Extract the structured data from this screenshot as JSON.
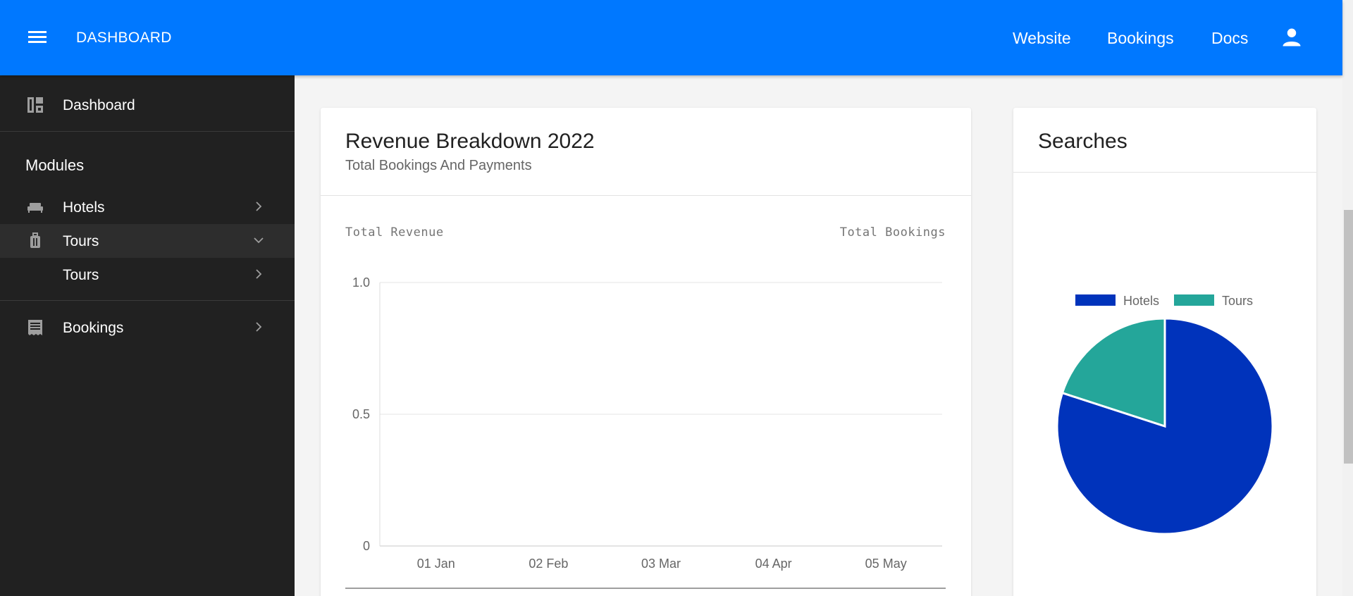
{
  "header": {
    "brand": "DASHBOARD",
    "nav": [
      "Website",
      "Bookings",
      "Docs"
    ],
    "icons": {
      "menu": "menu-icon",
      "user": "user-icon"
    }
  },
  "sidebar": {
    "dashboard_label": "Dashboard",
    "section_title": "Modules",
    "items": [
      {
        "label": "Hotels",
        "icon": "bed-icon",
        "chevron": "chevron-right"
      },
      {
        "label": "Tours",
        "icon": "luggage-icon",
        "chevron": "chevron-down"
      },
      {
        "label": "Tours",
        "icon": "",
        "chevron": "chevron-right"
      },
      {
        "label": "Bookings",
        "icon": "receipt-icon",
        "chevron": "chevron-right"
      }
    ]
  },
  "revenue_card": {
    "title": "Revenue Breakdown 2022",
    "subtitle": "Total Bookings And Payments",
    "left_axis_label": "Total Revenue",
    "right_axis_label": "Total Bookings"
  },
  "searches_card": {
    "title": "Searches"
  },
  "colors": {
    "header": "#0078ff",
    "sidebar": "#212121",
    "hotels": "#0033bb",
    "tours": "#24a69a"
  },
  "chart_data": [
    {
      "type": "line",
      "categories": [
        "01 Jan",
        "02 Feb",
        "03 Mar",
        "04 Apr",
        "05 May"
      ],
      "yticks": [
        "1.0",
        "0.5",
        "0"
      ],
      "ylim": [
        0,
        1
      ],
      "series": [],
      "grid": true
    },
    {
      "type": "pie",
      "labels": [
        "Hotels",
        "Tours"
      ],
      "values": [
        80,
        20
      ],
      "legend": "top"
    }
  ]
}
